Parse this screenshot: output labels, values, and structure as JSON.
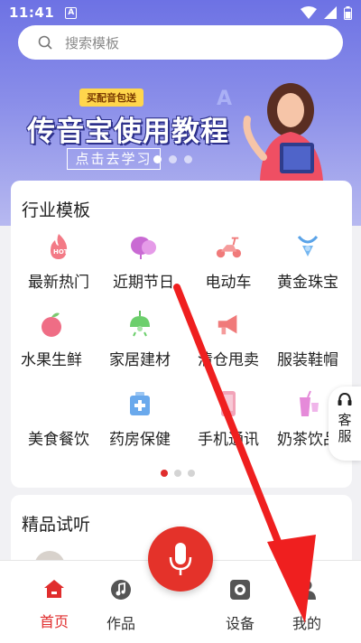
{
  "status_bar": {
    "time": "11:41",
    "notification_badge": "A"
  },
  "search": {
    "placeholder": "搜索模板"
  },
  "banner": {
    "tag": "买配音包送",
    "headline": "传音宝使用教程",
    "cta": "点击去学习"
  },
  "industry": {
    "title": "行业模板",
    "items": [
      {
        "label": "最新热门",
        "icon": "hot-icon"
      },
      {
        "label": "近期节日",
        "icon": "lantern-icon"
      },
      {
        "label": "电动车",
        "icon": "scooter-icon"
      },
      {
        "label": "黄金珠宝",
        "icon": "jewelry-icon"
      },
      {
        "label": "水果生鲜",
        "icon": "apple-icon"
      },
      {
        "label": "家居建材",
        "icon": "lamp-icon"
      },
      {
        "label": "清仓甩卖",
        "icon": "megaphone-icon"
      },
      {
        "label": "服装鞋帽",
        "icon": "clothes-icon"
      },
      {
        "label": "美食餐饮",
        "icon": "food-icon"
      },
      {
        "label": "药房保健",
        "icon": "medicine-icon"
      },
      {
        "label": "手机通讯",
        "icon": "phone-icon"
      },
      {
        "label": "奶茶饮品",
        "icon": "drink-icon"
      }
    ],
    "pager": {
      "pages": 3,
      "active": 1
    }
  },
  "preview": {
    "title": "精品试听"
  },
  "service": {
    "label": "客服"
  },
  "bottom_nav": {
    "items": [
      {
        "label": "首页",
        "icon": "home-icon",
        "active": true
      },
      {
        "label": "作品",
        "icon": "music-icon",
        "active": false
      },
      {
        "label": "设备",
        "icon": "device-icon",
        "active": false
      },
      {
        "label": "我的",
        "icon": "profile-icon",
        "active": false
      }
    ]
  },
  "colors": {
    "accent": "#e02d2d",
    "header_bg": "#6d72e4",
    "icon_pink": "#e8508b"
  }
}
